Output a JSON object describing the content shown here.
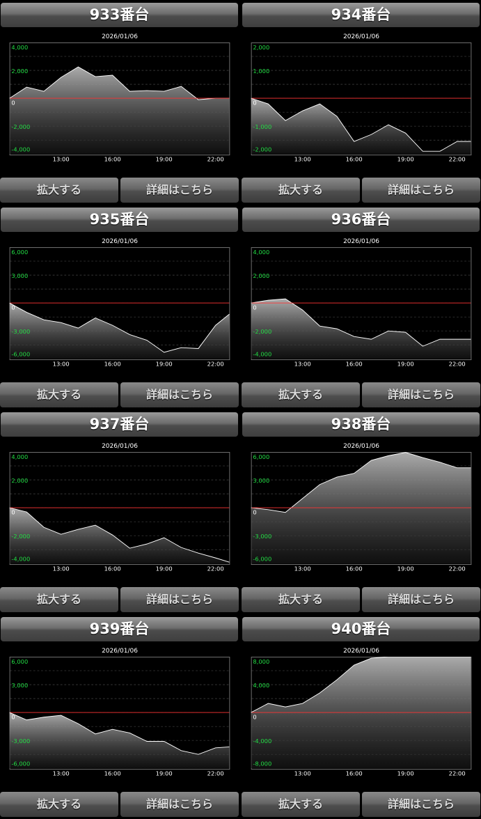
{
  "colors": {
    "ytick": "#22dd44",
    "xtick": "#ffffff",
    "zero": "#ff3333",
    "line": "#ffffff"
  },
  "buttons": {
    "zoom": "拡大する",
    "detail": "詳細はこちら"
  },
  "machines": [
    {
      "title": "933番台",
      "date": "2026/01/06",
      "chart_data": {
        "type": "area",
        "xlim": [
          10,
          22.8
        ],
        "x": [
          10,
          11,
          12,
          13,
          14,
          15,
          16,
          17,
          18,
          19,
          20,
          21,
          22,
          22.8
        ],
        "values": [
          0,
          800,
          500,
          1500,
          2250,
          1550,
          1650,
          500,
          550,
          500,
          850,
          -100,
          0,
          0
        ],
        "ylim": [
          -4000,
          4000
        ],
        "yticks": [
          4000,
          2000,
          0,
          -2000,
          -4000
        ],
        "ytick_labels": [
          "4,000",
          "2,000",
          "0",
          "-2,000",
          "-4,000"
        ],
        "xticks": [
          13,
          16,
          19,
          22
        ],
        "xtick_labels": [
          "13:00",
          "16:00",
          "19:00",
          "22:00"
        ]
      }
    },
    {
      "title": "934番台",
      "date": "2026/01/06",
      "chart_data": {
        "type": "area",
        "xlim": [
          10,
          22.8
        ],
        "x": [
          10,
          11,
          12,
          13,
          14,
          15,
          16,
          17,
          18,
          19,
          20,
          21,
          22,
          22.8
        ],
        "values": [
          0,
          -200,
          -800,
          -450,
          -200,
          -650,
          -1550,
          -1300,
          -950,
          -1250,
          -1900,
          -1900,
          -1550,
          -1550
        ],
        "ylim": [
          -2000,
          2000
        ],
        "yticks": [
          2000,
          1000,
          0,
          -1000,
          -2000
        ],
        "ytick_labels": [
          "2,000",
          "1,000",
          "0",
          "-1,000",
          "-2,000"
        ],
        "xticks": [
          13,
          16,
          19,
          22
        ],
        "xtick_labels": [
          "13:00",
          "16:00",
          "19:00",
          "22:00"
        ]
      }
    },
    {
      "title": "935番台",
      "date": "2026/01/06",
      "chart_data": {
        "type": "area",
        "xlim": [
          10,
          22.8
        ],
        "x": [
          10,
          11,
          12,
          13,
          14,
          15,
          16,
          17,
          18,
          19,
          20,
          21,
          22,
          22.8
        ],
        "values": [
          0,
          -1000,
          -1800,
          -2100,
          -2700,
          -1600,
          -2400,
          -3400,
          -4000,
          -5300,
          -4800,
          -4900,
          -2400,
          -1200
        ],
        "ylim": [
          -6000,
          6000
        ],
        "yticks": [
          6000,
          3000,
          0,
          -3000,
          -6000
        ],
        "ytick_labels": [
          "6,000",
          "3,000",
          "0",
          "-3,000",
          "-6,000"
        ],
        "xticks": [
          13,
          16,
          19,
          22
        ],
        "xtick_labels": [
          "13:00",
          "16:00",
          "19:00",
          "22:00"
        ]
      }
    },
    {
      "title": "936番台",
      "date": "2026/01/06",
      "chart_data": {
        "type": "area",
        "xlim": [
          10,
          22.8
        ],
        "x": [
          10,
          11,
          12,
          13,
          14,
          15,
          16,
          17,
          18,
          19,
          20,
          21,
          22,
          22.8
        ],
        "values": [
          0,
          200,
          300,
          -500,
          -1650,
          -1850,
          -2400,
          -2600,
          -2000,
          -2100,
          -3100,
          -2600,
          -2600,
          -2600
        ],
        "ylim": [
          -4000,
          4000
        ],
        "yticks": [
          4000,
          2000,
          0,
          -2000,
          -4000
        ],
        "ytick_labels": [
          "4,000",
          "2,000",
          "0",
          "-2,000",
          "-4,000"
        ],
        "xticks": [
          13,
          16,
          19,
          22
        ],
        "xtick_labels": [
          "13:00",
          "16:00",
          "19:00",
          "22:00"
        ]
      }
    },
    {
      "title": "937番台",
      "date": "2026/01/06",
      "chart_data": {
        "type": "area",
        "xlim": [
          10,
          22.8
        ],
        "x": [
          10,
          11,
          12,
          13,
          14,
          15,
          16,
          17,
          18,
          19,
          20,
          21,
          22,
          22.8
        ],
        "values": [
          0,
          -300,
          -1400,
          -1900,
          -1550,
          -1250,
          -1950,
          -2900,
          -2600,
          -2150,
          -2850,
          -3250,
          -3600,
          -3900
        ],
        "ylim": [
          -4000,
          4000
        ],
        "yticks": [
          4000,
          2000,
          0,
          -2000,
          -4000
        ],
        "ytick_labels": [
          "4,000",
          "2,000",
          "0",
          "-2,000",
          "-4,000"
        ],
        "xticks": [
          13,
          16,
          19,
          22
        ],
        "xtick_labels": [
          "13:00",
          "16:00",
          "19:00",
          "22:00"
        ]
      }
    },
    {
      "title": "938番台",
      "date": "2026/01/06",
      "chart_data": {
        "type": "area",
        "xlim": [
          10,
          22.8
        ],
        "x": [
          10,
          11,
          12,
          13,
          14,
          15,
          16,
          17,
          18,
          19,
          20,
          21,
          22,
          22.8
        ],
        "values": [
          0,
          -200,
          -500,
          1000,
          2500,
          3300,
          3700,
          5100,
          5600,
          5950,
          5400,
          4900,
          4300,
          4300
        ],
        "ylim": [
          -6000,
          6000
        ],
        "yticks": [
          6000,
          3000,
          0,
          -3000,
          -6000
        ],
        "ytick_labels": [
          "6,000",
          "3,000",
          "0",
          "-3,000",
          "-6,000"
        ],
        "xticks": [
          13,
          16,
          19,
          22
        ],
        "xtick_labels": [
          "13:00",
          "16:00",
          "19:00",
          "22:00"
        ]
      }
    },
    {
      "title": "939番台",
      "date": "2026/01/06",
      "chart_data": {
        "type": "area",
        "xlim": [
          10,
          22.8
        ],
        "x": [
          10,
          11,
          12,
          13,
          14,
          15,
          16,
          17,
          18,
          19,
          20,
          21,
          22,
          22.8
        ],
        "values": [
          0,
          -800,
          -500,
          -300,
          -1200,
          -2300,
          -1800,
          -2200,
          -3100,
          -3100,
          -4100,
          -4500,
          -3800,
          -3700
        ],
        "ylim": [
          -6000,
          6000
        ],
        "yticks": [
          6000,
          3000,
          0,
          -3000,
          -6000
        ],
        "ytick_labels": [
          "6,000",
          "3,000",
          "0",
          "-3,000",
          "-6,000"
        ],
        "xticks": [
          13,
          16,
          19,
          22
        ],
        "xtick_labels": [
          "13:00",
          "16:00",
          "19:00",
          "22:00"
        ]
      }
    },
    {
      "title": "940番台",
      "date": "2026/01/06",
      "chart_data": {
        "type": "area",
        "xlim": [
          10,
          22.8
        ],
        "x": [
          10,
          11,
          12,
          13,
          14,
          15,
          16,
          17,
          18,
          19,
          20,
          21,
          22,
          22.8
        ],
        "values": [
          0,
          1300,
          800,
          1300,
          2800,
          4700,
          6800,
          7800,
          8900,
          8800,
          9600,
          9400,
          8400,
          8400
        ],
        "ylim": [
          -8000,
          8000
        ],
        "yticks": [
          8000,
          4000,
          0,
          -4000,
          -8000
        ],
        "ytick_labels": [
          "8,000",
          "4,000",
          "0",
          "-4,000",
          "-8,000"
        ],
        "xticks": [
          13,
          16,
          19,
          22
        ],
        "xtick_labels": [
          "13:00",
          "16:00",
          "19:00",
          "22:00"
        ]
      }
    }
  ]
}
